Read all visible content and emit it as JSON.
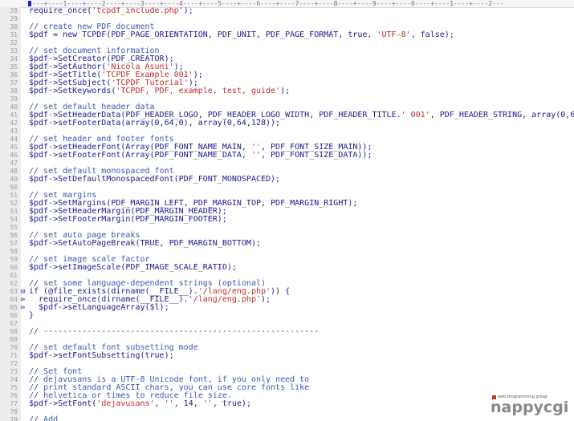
{
  "ruler": {
    "text": "---+----1----+----2----+----3----+----4----+----5----+----6----+----7----+----8----+----9----+----0----+----1----+----2---"
  },
  "lines": [
    {
      "n": "28",
      "segs": [
        [
          "k",
          "require_once("
        ],
        [
          "s",
          "'tcpdf_include.php'"
        ],
        [
          "k",
          ");"
        ]
      ]
    },
    {
      "n": "29",
      "segs": []
    },
    {
      "n": "30",
      "segs": [
        [
          "c",
          "// create new PDF document"
        ]
      ]
    },
    {
      "n": "31",
      "segs": [
        [
          "k",
          "$pdf = new TCPDF(PDF_PAGE_ORIENTATION, PDF_UNIT, PDF_PAGE_FORMAT, true, "
        ],
        [
          "s",
          "'UTF-8'"
        ],
        [
          "k",
          ", false);"
        ]
      ]
    },
    {
      "n": "32",
      "segs": []
    },
    {
      "n": "33",
      "segs": [
        [
          "c",
          "// set document information"
        ]
      ]
    },
    {
      "n": "34",
      "segs": [
        [
          "k",
          "$pdf->SetCreator(PDF_CREATOR);"
        ]
      ]
    },
    {
      "n": "35",
      "segs": [
        [
          "k",
          "$pdf->SetAuthor("
        ],
        [
          "s",
          "'Nicola Asuni'"
        ],
        [
          "k",
          ");"
        ]
      ]
    },
    {
      "n": "36",
      "segs": [
        [
          "k",
          "$pdf->SetTitle("
        ],
        [
          "s",
          "'TCPDF Example 001'"
        ],
        [
          "k",
          ");"
        ]
      ]
    },
    {
      "n": "37",
      "segs": [
        [
          "k",
          "$pdf->SetSubject("
        ],
        [
          "s",
          "'TCPDF Tutorial'"
        ],
        [
          "k",
          ");"
        ]
      ]
    },
    {
      "n": "38",
      "segs": [
        [
          "k",
          "$pdf->SetKeywords("
        ],
        [
          "s",
          "'TCPDF, PDF, example, test, guide'"
        ],
        [
          "k",
          ");"
        ]
      ]
    },
    {
      "n": "39",
      "segs": []
    },
    {
      "n": "40",
      "segs": [
        [
          "c",
          "// set default header data"
        ]
      ]
    },
    {
      "n": "41",
      "segs": [
        [
          "k",
          "$pdf->SetHeaderData(PDF_HEADER_LOGO, PDF_HEADER_LOGO_WIDTH, PDF_HEADER_TITLE."
        ],
        [
          "s",
          "' 001'"
        ],
        [
          "k",
          ", PDF_HEADER_STRING, array(0,64,255), array("
        ]
      ]
    },
    {
      "n": "42",
      "segs": [
        [
          "k",
          "$pdf->setFooterData(array(0,64,0), array(0,64,128));"
        ]
      ]
    },
    {
      "n": "43",
      "segs": []
    },
    {
      "n": "44",
      "segs": [
        [
          "c",
          "// set header and footer fonts"
        ]
      ]
    },
    {
      "n": "45",
      "segs": [
        [
          "k",
          "$pdf->setHeaderFont(Array(PDF_FONT_NAME_MAIN, "
        ],
        [
          "s",
          "''"
        ],
        [
          "k",
          ", PDF_FONT_SIZE_MAIN));"
        ]
      ]
    },
    {
      "n": "46",
      "segs": [
        [
          "k",
          "$pdf->setFooterFont(Array(PDF_FONT_NAME_DATA, "
        ],
        [
          "s",
          "''"
        ],
        [
          "k",
          ", PDF_FONT_SIZE_DATA));"
        ]
      ]
    },
    {
      "n": "47",
      "segs": []
    },
    {
      "n": "48",
      "segs": [
        [
          "c",
          "// set default monospaced font"
        ]
      ]
    },
    {
      "n": "49",
      "segs": [
        [
          "k",
          "$pdf->SetDefaultMonospacedFont(PDF_FONT_MONOSPACED);"
        ]
      ]
    },
    {
      "n": "50",
      "segs": []
    },
    {
      "n": "51",
      "segs": [
        [
          "c",
          "// set margins"
        ]
      ]
    },
    {
      "n": "52",
      "segs": [
        [
          "k",
          "$pdf->SetMargins(PDF_MARGIN_LEFT, PDF_MARGIN_TOP, PDF_MARGIN_RIGHT);"
        ]
      ]
    },
    {
      "n": "53",
      "segs": [
        [
          "k",
          "$pdf->SetHeaderMargin(PDF_MARGIN_HEADER);"
        ]
      ]
    },
    {
      "n": "54",
      "segs": [
        [
          "k",
          "$pdf->SetFooterMargin(PDF_MARGIN_FOOTER);"
        ]
      ]
    },
    {
      "n": "55",
      "segs": []
    },
    {
      "n": "56",
      "segs": [
        [
          "c",
          "// set auto page breaks"
        ]
      ]
    },
    {
      "n": "57",
      "segs": [
        [
          "k",
          "$pdf->SetAutoPageBreak(TRUE, PDF_MARGIN_BOTTOM);"
        ]
      ]
    },
    {
      "n": "58",
      "segs": []
    },
    {
      "n": "59",
      "segs": [
        [
          "c",
          "// set image scale factor"
        ]
      ]
    },
    {
      "n": "60",
      "segs": [
        [
          "k",
          "$pdf->setImageScale(PDF_IMAGE_SCALE_RATIO);"
        ]
      ]
    },
    {
      "n": "61",
      "segs": []
    },
    {
      "n": "62",
      "segs": [
        [
          "c",
          "// set some language-dependent strings (optional)"
        ]
      ]
    },
    {
      "n": "63",
      "mark": "⊟",
      "segs": [
        [
          "k",
          "if (@file_exists(dirname(__FILE__)."
        ],
        [
          "s",
          "'/lang/eng.php'"
        ],
        [
          "k",
          ")) {"
        ]
      ]
    },
    {
      "n": "64",
      "mark": "⊳",
      "segs": [
        [
          "k",
          "  require_once(dirname(__FILE__)."
        ],
        [
          "s",
          "'/lang/eng.php'"
        ],
        [
          "k",
          ");"
        ]
      ]
    },
    {
      "n": "65",
      "mark": "⊳",
      "segs": [
        [
          "k",
          "  $pdf->setLanguageArray($l);"
        ]
      ]
    },
    {
      "n": "66",
      "segs": [
        [
          "k",
          "}"
        ]
      ]
    },
    {
      "n": "67",
      "segs": []
    },
    {
      "n": "68",
      "segs": [
        [
          "c",
          "// ---------------------------------------------------------"
        ]
      ]
    },
    {
      "n": "69",
      "segs": []
    },
    {
      "n": "70",
      "segs": [
        [
          "c",
          "// set default font subsetting mode"
        ]
      ]
    },
    {
      "n": "71",
      "segs": [
        [
          "k",
          "$pdf->setFontSubsetting(true);"
        ]
      ]
    },
    {
      "n": "72",
      "segs": []
    },
    {
      "n": "73",
      "segs": [
        [
          "c",
          "// Set font"
        ]
      ]
    },
    {
      "n": "74",
      "segs": [
        [
          "c",
          "// dejavusans is a UTF-8 Unicode font, if you only need to"
        ]
      ]
    },
    {
      "n": "75",
      "segs": [
        [
          "c",
          "// print standard ASCII chars, you can use core fonts like"
        ]
      ]
    },
    {
      "n": "76",
      "segs": [
        [
          "c",
          "// helvetica or times to reduce file size."
        ]
      ]
    },
    {
      "n": "77",
      "segs": [
        [
          "k",
          "$pdf->SetFont("
        ],
        [
          "s",
          "'dejavusans'"
        ],
        [
          "k",
          ", "
        ],
        [
          "s",
          "''"
        ],
        [
          "k",
          ", 14, "
        ],
        [
          "s",
          "''"
        ],
        [
          "k",
          ", true);"
        ]
      ]
    },
    {
      "n": "78",
      "segs": []
    },
    {
      "n": "79",
      "segs": [
        [
          "c",
          "// Add"
        ]
      ]
    }
  ],
  "logo": {
    "tagline": "web programming group",
    "wordmark": "nappycgi"
  }
}
